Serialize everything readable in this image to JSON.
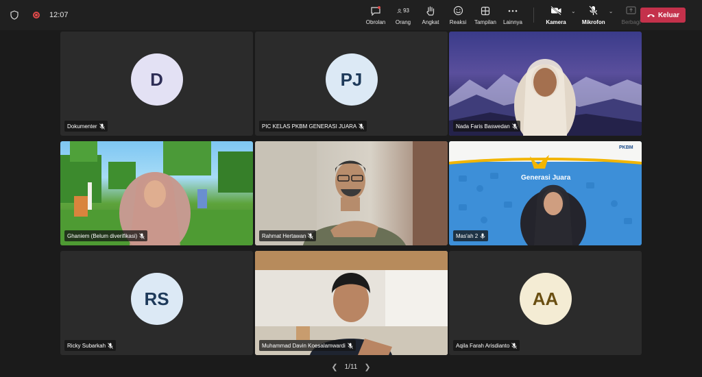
{
  "status": {
    "time": "12:07"
  },
  "toolbar": {
    "chat": "Obrolan",
    "people": "Orang",
    "people_count": "93",
    "raise": "Angkat",
    "react": "Reaksi",
    "view": "Tampilan",
    "more": "Lainnya",
    "camera": "Kamera",
    "mic": "Mikrofon",
    "share": "Berbagi",
    "leave": "Keluar"
  },
  "participants": [
    {
      "name": "Dokumenter",
      "initials": "D",
      "avatar_color": "#e3e1f4"
    },
    {
      "name": "PIC KELAS PKBM GENERASI JUARA",
      "initials": "PJ",
      "avatar_color": "#dce9f5"
    },
    {
      "name": "Nada Faris Baswedan"
    },
    {
      "name": "Ghaniem (Belum diverifikasi)"
    },
    {
      "name": "Rahmat Hertawan"
    },
    {
      "name": "Mas'ah 2"
    },
    {
      "name": "Ricky Subarkah",
      "initials": "RS",
      "avatar_color": "#dce9f5"
    },
    {
      "name": "Muhammad Davin Koesalamwardi"
    },
    {
      "name": "Aqila Farah Arisdianto",
      "initials": "AA",
      "avatar_color": "#f4ecd4"
    }
  ],
  "video_panel": {
    "brand": "Generasi Juara",
    "org": "PKBM"
  },
  "pager": {
    "label": "1/11"
  },
  "colors": {
    "leave": "#c4314b",
    "background": "#1b1b1b",
    "tile": "#2b2b2b"
  }
}
